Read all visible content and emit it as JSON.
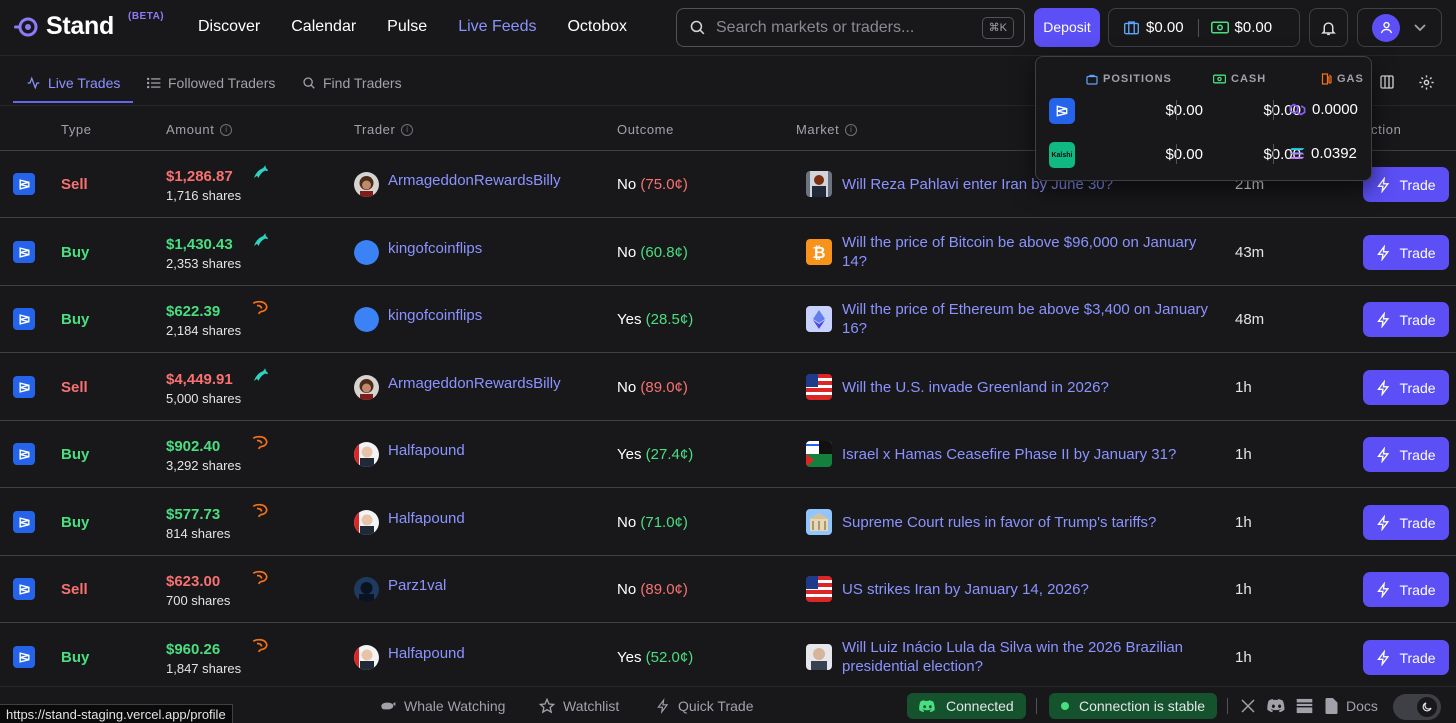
{
  "brand": {
    "name": "Stand",
    "badge": "(BETA)"
  },
  "nav": [
    "Discover",
    "Calendar",
    "Pulse",
    "Live Feeds",
    "Octobox"
  ],
  "nav_active": "Live Feeds",
  "search": {
    "placeholder": "Search markets or traders...",
    "shortcut": "⌘K"
  },
  "header": {
    "deposit": "Deposit",
    "balance1": "$0.00",
    "balance2": "$0.00"
  },
  "subnav": {
    "tabs": [
      "Live Trades",
      "Followed Traders",
      "Find Traders"
    ],
    "active": "Live Trades"
  },
  "table": {
    "headers": {
      "type": "Type",
      "amount": "Amount",
      "trader": "Trader",
      "outcome": "Outcome",
      "market": "Market",
      "action": "ction"
    },
    "rows": [
      {
        "type": "Sell",
        "amount": "$1,286.87",
        "shares": "1,716 shares",
        "tier": "dolphin",
        "trader": "ArmageddonRewardsBilly",
        "outcome": "No",
        "price": "(75.0¢)",
        "price_tone": "red",
        "market": "Will Reza Pahlavi enter Iran by June 30?",
        "time": "21m",
        "thumb": "portrait"
      },
      {
        "type": "Buy",
        "amount": "$1,430.43",
        "shares": "2,353 shares",
        "tier": "dolphin",
        "trader": "kingofcoinflips",
        "outcome": "No",
        "price": "(60.8¢)",
        "price_tone": "green",
        "market": "Will the price of Bitcoin be above $96,000 on January 14?",
        "time": "43m",
        "thumb": "bitcoin"
      },
      {
        "type": "Buy",
        "amount": "$622.39",
        "shares": "2,184 shares",
        "tier": "shrimp",
        "trader": "kingofcoinflips",
        "outcome": "Yes",
        "price": "(28.5¢)",
        "price_tone": "green",
        "market": "Will the price of Ethereum be above $3,400 on January 16?",
        "time": "48m",
        "thumb": "ethereum"
      },
      {
        "type": "Sell",
        "amount": "$4,449.91",
        "shares": "5,000 shares",
        "tier": "dolphin",
        "trader": "ArmageddonRewardsBilly",
        "outcome": "No",
        "price": "(89.0¢)",
        "price_tone": "red",
        "market": "Will the U.S. invade Greenland in 2026?",
        "time": "1h",
        "thumb": "flag-us"
      },
      {
        "type": "Buy",
        "amount": "$902.40",
        "shares": "3,292 shares",
        "tier": "shrimp",
        "trader": "Halfapound",
        "outcome": "Yes",
        "price": "(27.4¢)",
        "price_tone": "green",
        "market": "Israel x Hamas Ceasefire Phase II by January 31?",
        "time": "1h",
        "thumb": "flags-mixed"
      },
      {
        "type": "Buy",
        "amount": "$577.73",
        "shares": "814 shares",
        "tier": "shrimp",
        "trader": "Halfapound",
        "outcome": "No",
        "price": "(71.0¢)",
        "price_tone": "green",
        "market": "Supreme Court rules in favor of Trump's tariffs?",
        "time": "1h",
        "thumb": "building"
      },
      {
        "type": "Sell",
        "amount": "$623.00",
        "shares": "700 shares",
        "tier": "shrimp",
        "trader": "Parz1val",
        "outcome": "No",
        "price": "(89.0¢)",
        "price_tone": "red",
        "market": "US strikes Iran by January 14, 2026?",
        "time": "1h",
        "thumb": "flag-us"
      },
      {
        "type": "Buy",
        "amount": "$960.26",
        "shares": "1,847 shares",
        "tier": "shrimp",
        "trader": "Halfapound",
        "outcome": "Yes",
        "price": "(52.0¢)",
        "price_tone": "green",
        "market": "Will Luiz Inácio Lula da Silva win the 2026 Brazilian presidential election?",
        "time": "1h",
        "thumb": "portrait-light"
      }
    ],
    "trade_label": "Trade"
  },
  "wallet": {
    "headers": {
      "positions": "POSITIONS",
      "cash": "CASH",
      "gas": "GAS"
    },
    "rows": [
      {
        "platform": "polymarket",
        "positions": "$0.00",
        "cash": "$0.00",
        "gas": "0.0000"
      },
      {
        "platform": "Kalshi",
        "positions": "$0.00",
        "cash": "$0.00",
        "gas": "0.0392"
      }
    ]
  },
  "footer": {
    "whale": "Whale Watching",
    "watchlist": "Watchlist",
    "quick_trade": "Quick Trade",
    "connected": "Connected",
    "stable": "Connection is stable",
    "docs": "Docs"
  },
  "status_url": "https://stand-staging.vercel.app/profile",
  "colors": {
    "accent": "#5b4ff5",
    "link": "#8b93ff",
    "sell": "#f87171",
    "buy": "#4ade80",
    "background": "#18181b"
  }
}
